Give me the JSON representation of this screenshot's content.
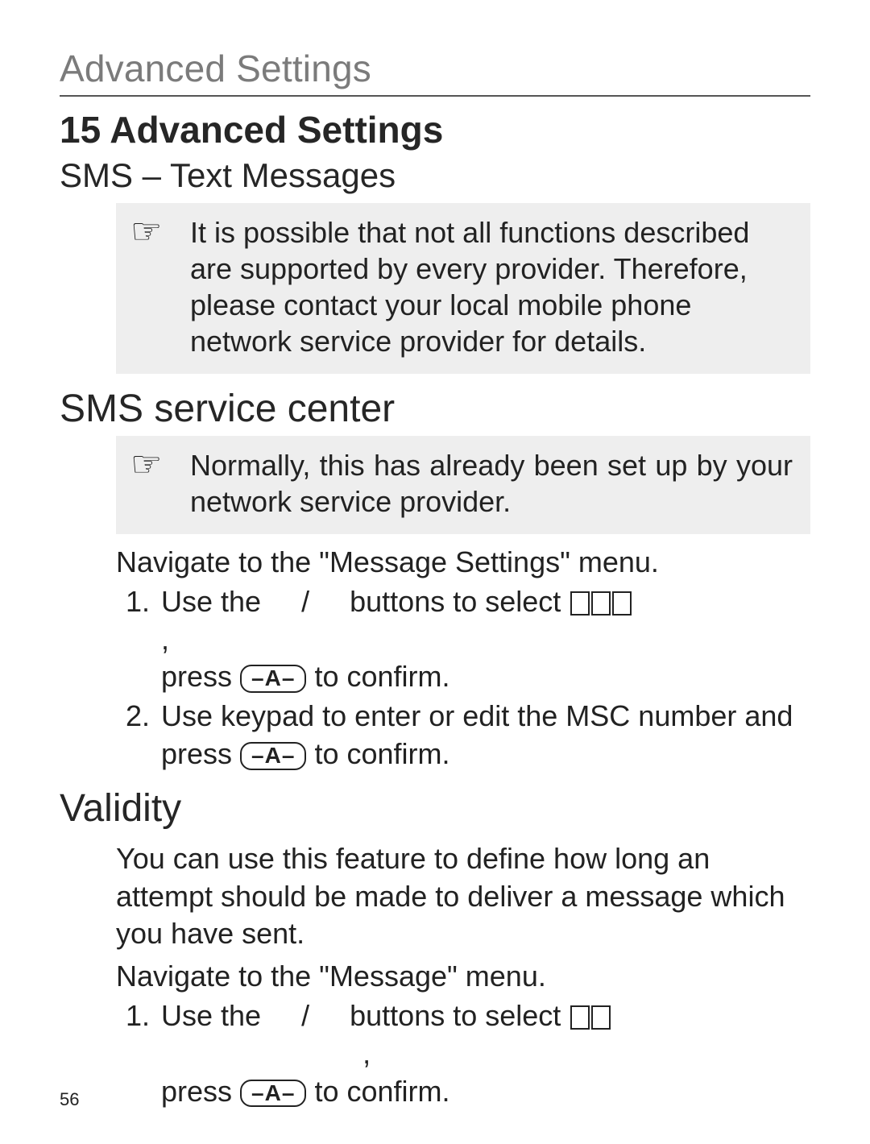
{
  "running_head": "Advanced Settings",
  "h1": "15 Advanced Settings",
  "sms_heading": "SMS – Text Messages",
  "note1_icon": "☞",
  "note1_text": "It is possible that not all functions described are supported by every provider. Therefore, please contact your local mobile phone network service provider for details.",
  "service_center_heading": "SMS service center",
  "note2_icon": "☞",
  "note2_text": "Normally, this has already been set up by your network service provider.",
  "sc_intro": "Navigate to the \"Message Settings\" menu.",
  "sc_step1_a": "Use the",
  "sc_step1_b": "/",
  "sc_step1_c": "buttons to select",
  "sc_step1_tail": ",",
  "sc_step1_line2a": "press",
  "key_label": "–A–",
  "sc_step1_line2b": "to conﬁrm.",
  "sc_step2_a": "Use keypad to enter or edit the MSC number and press",
  "sc_step2_b": "to conﬁrm.",
  "validity_heading": "Validity",
  "validity_intro": "You can use this feature to deﬁne how long an attempt should be made to deliver a message which you have sent.",
  "validity_nav": "Navigate to the \"Message\" menu.",
  "v_step1_a": "Use the",
  "v_step1_b": "/",
  "v_step1_c": "buttons to select",
  "v_step1_tail": ",",
  "v_step1_line2a": "press",
  "v_step1_line2b": "to conﬁrm.",
  "page_number": "56"
}
